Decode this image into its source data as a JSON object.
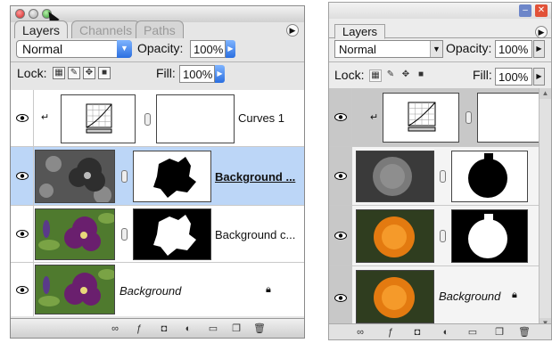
{
  "mac": {
    "tabs": [
      "Layers",
      "Channels",
      "Paths"
    ],
    "blend_mode": "Normal",
    "opacity_label": "Opacity:",
    "opacity_value": "100%",
    "lock_label": "Lock:",
    "fill_label": "Fill:",
    "fill_value": "100%",
    "layers": [
      {
        "name": "Curves 1"
      },
      {
        "name": "Background ..."
      },
      {
        "name": "Background c..."
      },
      {
        "name": "Background"
      }
    ]
  },
  "win": {
    "tab": "Layers",
    "blend_mode": "Normal",
    "opacity_label": "Opacity:",
    "opacity_value": "100%",
    "lock_label": "Lock:",
    "fill_label": "Fill:",
    "fill_value": "100%",
    "layers": [
      {
        "name": ""
      },
      {
        "name": ""
      },
      {
        "name": ""
      },
      {
        "name": "Background"
      }
    ]
  },
  "colors": {
    "selection": "#bcd6f7",
    "accent": "#2b6fe0",
    "petunia": "#6a1f6e",
    "marigold": "#f08a1a"
  }
}
